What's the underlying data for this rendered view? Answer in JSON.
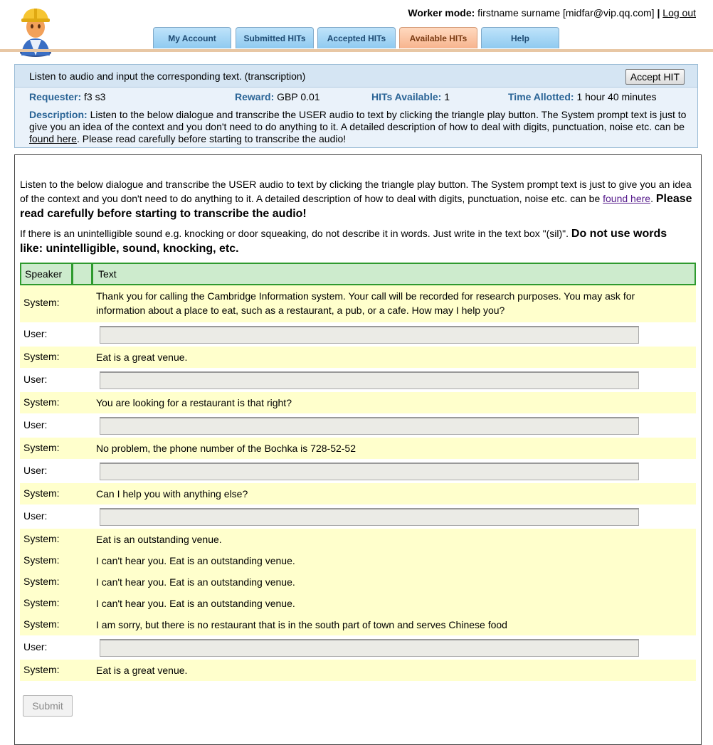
{
  "header": {
    "worker_mode_label": "Worker mode:",
    "worker_identity": "firstname surname [midfar@vip.qq.com]",
    "separator": "|",
    "logout_label": "Log out",
    "tabs": [
      {
        "label": "My Account"
      },
      {
        "label": "Submitted HITs"
      },
      {
        "label": "Accepted HITs"
      },
      {
        "label": "Available HITs",
        "active": true
      },
      {
        "label": "Help"
      }
    ]
  },
  "hit": {
    "title": "Listen to audio and input the corresponding text. (transcription)",
    "accept_label": "Accept HIT",
    "requester_label": "Requester:",
    "requester_value": "f3 s3",
    "reward_label": "Reward:",
    "reward_value": "GBP 0.01",
    "available_label": "HITs Available:",
    "available_value": "1",
    "time_label": "Time Allotted:",
    "time_value": "1 hour 40 minutes",
    "description_label": "Description:",
    "description_text": "Listen to the below dialogue and transcribe the USER audio to text by clicking the triangle play button. The System prompt text is just to give you an idea of the context and you don't need to do anything to it. A detailed description of how to deal with digits, punctuation, noise etc. can be",
    "description_link": "found here",
    "description_tail": ". Please read carefully before starting to transcribe the audio!"
  },
  "task": {
    "intro_text": "Listen to the below dialogue and transcribe the USER audio to text by clicking the triangle play button. The System prompt text is just to give you an idea of the context and you don't need to do anything to it. A detailed description of how to deal with digits, punctuation, noise etc. can be",
    "intro_link": "found here",
    "intro_period": ".",
    "intro_bold": "Please read carefully before starting to transcribe the audio!",
    "sil_text": "If there is an unintelligible sound e.g. knocking or door squeaking, do not describe it in words. Just write in the text box \"(sil)\".",
    "sil_bold": "Do not use words like: unintelligible, sound, knocking, etc.",
    "table_headers": {
      "speaker": "Speaker",
      "text": "Text"
    },
    "rows": [
      {
        "speaker": "System:",
        "text": "Thank you for calling the Cambridge Information system. Your call will be recorded for research purposes. You may ask for information about a place to eat, such as a restaurant, a pub, or a cafe. How may I help you?"
      },
      {
        "speaker": "User:",
        "value": ""
      },
      {
        "speaker": "System:",
        "text": "Eat is a great venue."
      },
      {
        "speaker": "User:",
        "value": ""
      },
      {
        "speaker": "System:",
        "text": "You are looking for a restaurant is that right?"
      },
      {
        "speaker": "User:",
        "value": ""
      },
      {
        "speaker": "System:",
        "text": "No problem, the phone number of the Bochka is 728-52-52"
      },
      {
        "speaker": "User:",
        "value": ""
      },
      {
        "speaker": "System:",
        "text": "Can I help you with anything else?"
      },
      {
        "speaker": "User:",
        "value": ""
      },
      {
        "speaker": "System:",
        "text": "Eat is an outstanding venue."
      },
      {
        "speaker": "System:",
        "text": "I can't hear you. Eat is an outstanding venue."
      },
      {
        "speaker": "System:",
        "text": "I can't hear you. Eat is an outstanding venue."
      },
      {
        "speaker": "System:",
        "text": "I can't hear you. Eat is an outstanding venue."
      },
      {
        "speaker": "System:",
        "text": "I am sorry, but there is no restaurant that is in the south part of town and serves Chinese food"
      },
      {
        "speaker": "User:",
        "value": ""
      },
      {
        "speaker": "System:",
        "text": "Eat is a great venue."
      }
    ],
    "submit_label": "Submit"
  }
}
